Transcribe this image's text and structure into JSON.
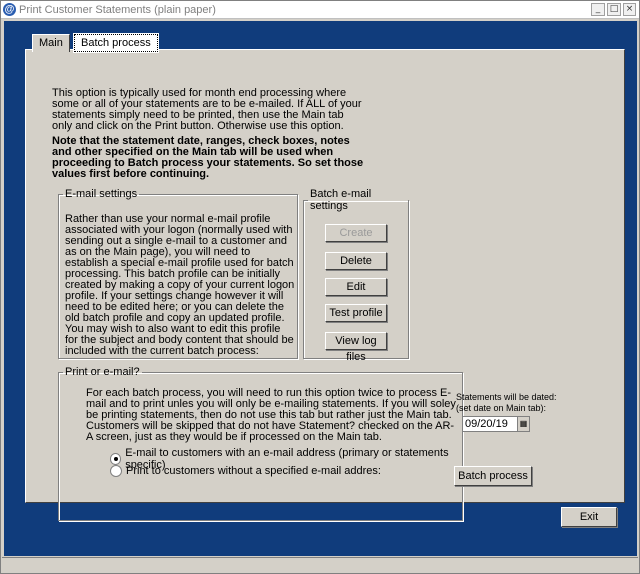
{
  "window": {
    "title": "Print Customer Statements (plain paper)"
  },
  "tabs": [
    {
      "label": "Main",
      "active": false
    },
    {
      "label": "Batch process",
      "active": true
    }
  ],
  "intro_text": "This option is typically used for month end processing where some or all of your statements are to be e-mailed.  If ALL of your statements simply need to be printed, then use the Main tab only and click on the Print button.  Otherwise use this option.",
  "note_text": "Note that the statement date, ranges, check boxes, notes  and other specified on the Main tab will be used when proceeding to Batch process your statements.  So set those values first before continuing.",
  "email_settings": {
    "legend": "E-mail settings",
    "text": "Rather than use your normal e-mail profile associated with your logon (normally used with sending out a single e-mail to a customer and as on the Main page), you will need to establish a special e-mail profile used for batch processing.  This batch profile can be initially created by making a copy of your current logon profile.  If your settings change however it will need to be edited here; or you can delete the old batch profile and copy an updated profile.  You may wish to also want to edit this profile for the subject and body content that should be included with the current batch process:"
  },
  "batch_settings": {
    "legend": "Batch e-mail settings",
    "buttons": [
      "Create",
      "Delete",
      "Edit",
      "Test profile",
      "View log files"
    ]
  },
  "print_or_email": {
    "legend": "Print or e-mail?",
    "text": "For each batch process, you will need to run this option twice to process E-mail and to print unles you will only be e-mailing statements.  If you will soley be printing statements, then do not use this tab but rather just the Main tab. Customers will be skipped that do not have Statement? checked on the AR-A screen, just as they would be if processed on the Main tab.",
    "options": [
      {
        "label": "E-mail to customers with an e-mail address (primary or statements specific)",
        "checked": true
      },
      {
        "label": "Print to customers without a specified e-mail addres:",
        "checked": false
      }
    ]
  },
  "statement_date": {
    "label": "Statements will be dated:",
    "sublabel": "(set date on Main tab):",
    "value": "09/20/19"
  },
  "actions": {
    "batch_process": "Batch process",
    "exit": "Exit"
  },
  "icons": {
    "app": "app-icon",
    "calendar": "calendar-icon"
  }
}
